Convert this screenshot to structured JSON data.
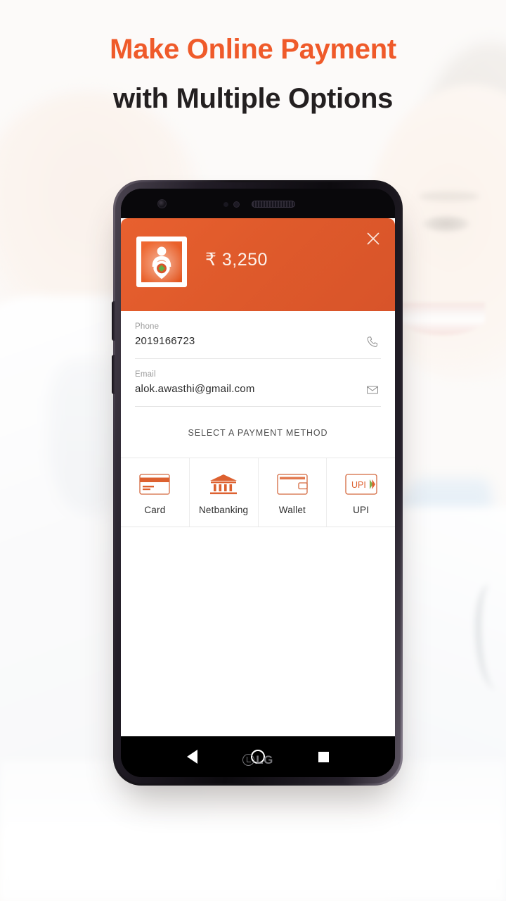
{
  "promo": {
    "headline_line1": "Make Online Payment",
    "headline_line2": "with Multiple Options",
    "accent_color": "#ef5a2a",
    "headline_color_2": "#231f20"
  },
  "device": {
    "brand": "LG",
    "icons": {
      "front_camera": "camera-icon",
      "earpiece": "speaker-grille-icon"
    }
  },
  "payment_sheet": {
    "header": {
      "amount": "₹ 3,250",
      "currency_symbol": "₹",
      "close_label": "×",
      "brand_color": "#df5a2b",
      "merchant_logo_alt": "merchant-logo"
    },
    "fields": [
      {
        "label": "Phone",
        "value": "2019166723",
        "placeholder": "Phone",
        "icon": "phone-icon"
      },
      {
        "label": "Email",
        "value": "alok.awasthi@gmail.com",
        "placeholder": "Email",
        "icon": "envelope-icon"
      }
    ],
    "section_title": "SELECT A PAYMENT METHOD",
    "methods": [
      {
        "label": "Card",
        "icon": "credit-card-icon"
      },
      {
        "label": "Netbanking",
        "icon": "bank-icon"
      },
      {
        "label": "Wallet",
        "icon": "wallet-icon"
      },
      {
        "label": "UPI",
        "icon": "upi-icon",
        "badge_text": "UPI"
      }
    ]
  },
  "navbar": {
    "back": "back-button",
    "home": "home-button",
    "recents": "recents-button"
  }
}
